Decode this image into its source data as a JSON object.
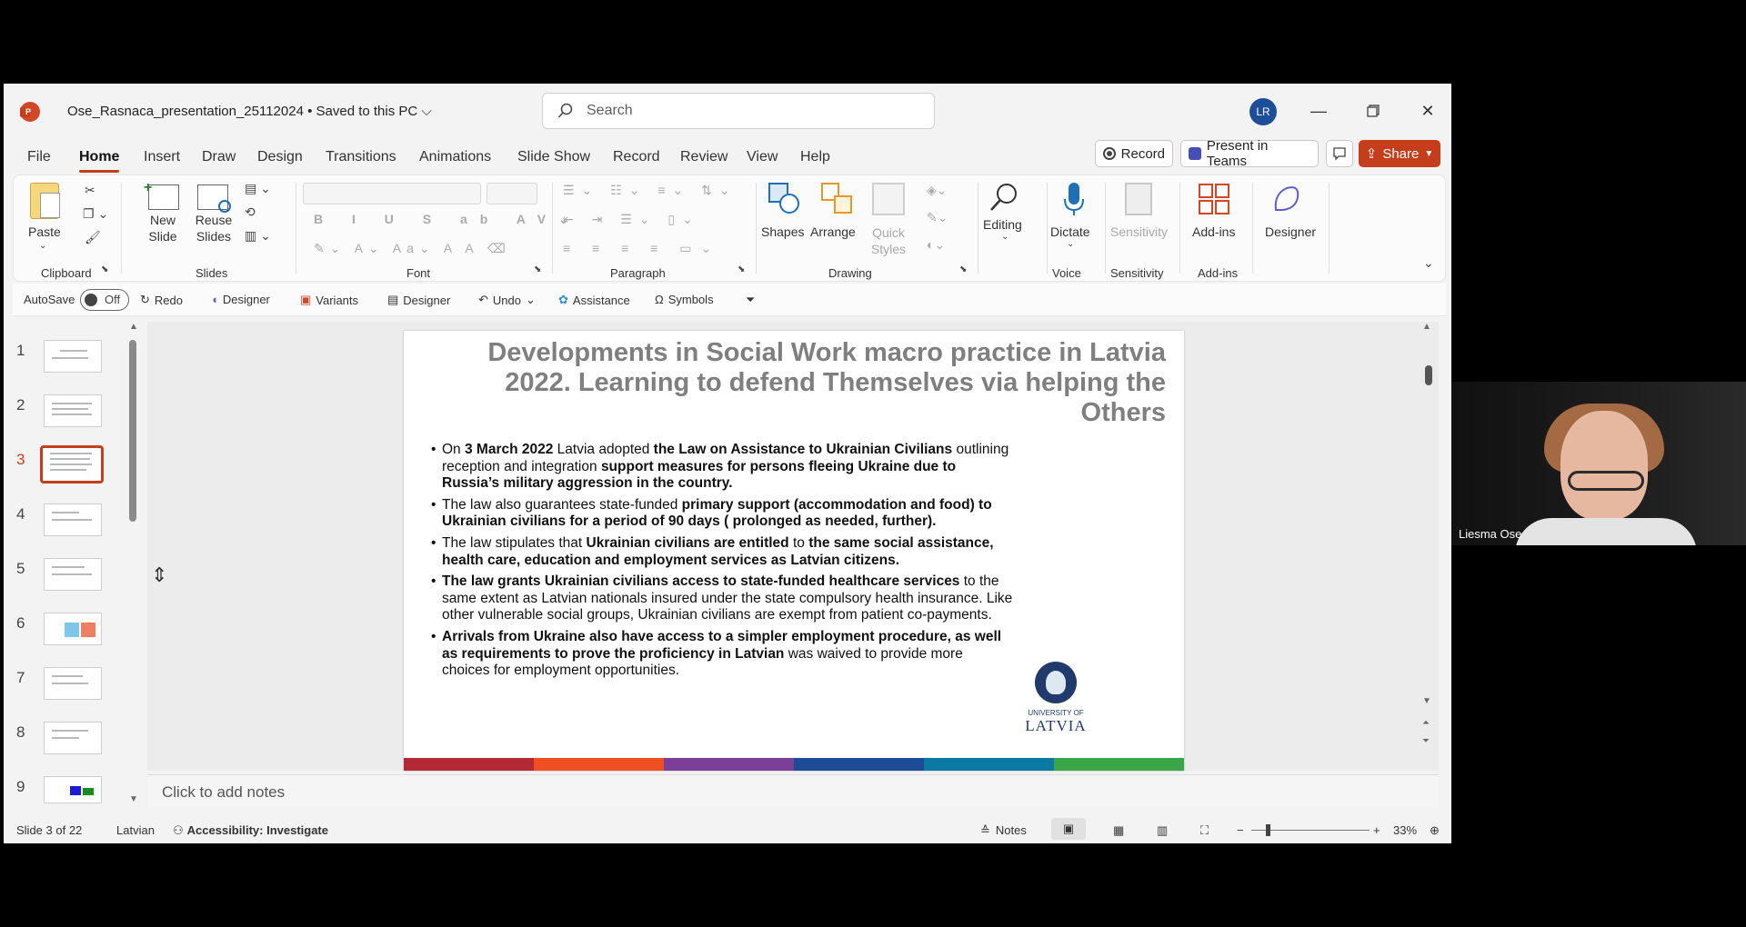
{
  "titlebar": {
    "document_title": "Ose_Rasnaca_presentation_25112024 • Saved to this PC ⌵",
    "search_placeholder": "Search",
    "avatar_initials": "LR"
  },
  "menu": {
    "tabs": [
      "File",
      "Home",
      "Insert",
      "Draw",
      "Design",
      "Transitions",
      "Animations",
      "Slide Show",
      "Record",
      "Review",
      "View",
      "Help"
    ],
    "active_tab": "Home",
    "record_button": "Record",
    "present_button": "Present in Teams",
    "share_button": "Share"
  },
  "ribbon": {
    "clipboard": {
      "paste": "Paste",
      "group": "Clipboard"
    },
    "slides": {
      "new_slide": "New Slide",
      "reuse_slides": "Reuse Slides",
      "group": "Slides"
    },
    "font": {
      "group": "Font"
    },
    "paragraph": {
      "group": "Paragraph"
    },
    "drawing": {
      "shapes": "Shapes",
      "arrange": "Arrange",
      "quick_styles": "Quick Styles",
      "group": "Drawing"
    },
    "editing": {
      "label": "Editing"
    },
    "voice": {
      "dictate": "Dictate",
      "group": "Voice"
    },
    "sensitivity": {
      "label": "Sensitivity",
      "group": "Sensitivity"
    },
    "addins": {
      "label": "Add-ins",
      "group": "Add-ins"
    },
    "designer": {
      "label": "Designer"
    }
  },
  "qat": {
    "autosave": "AutoSave",
    "autosave_state": "Off",
    "redo": "Redo",
    "designer1": "Designer",
    "variants": "Variants",
    "designer2": "Designer",
    "undo": "Undo",
    "assistance": "Assistance",
    "symbols": "Symbols"
  },
  "thumbnails": [
    "1",
    "2",
    "3",
    "4",
    "5",
    "6",
    "7",
    "8",
    "9"
  ],
  "active_slide_index": 3,
  "slide": {
    "title": "Developments in Social Work macro practice in Latvia 2022. Learning to defend Themselves via helping the Others",
    "bullets": [
      {
        "parts": [
          [
            "On ",
            false
          ],
          [
            "3 March 2022",
            true
          ],
          [
            " Latvia adopted ",
            false
          ],
          [
            "the Law on Assistance to Ukrainian Civilians",
            true
          ],
          [
            " outlining reception and integration ",
            false
          ],
          [
            "support measures for persons fleeing Ukraine due to Russia’s military aggression in the country.",
            true
          ]
        ]
      },
      {
        "parts": [
          [
            "The law also guarantees state-funded ",
            false
          ],
          [
            "primary support (accommodation and food) to Ukrainian civilians for a period of 90 days ( prolonged as needed, further).",
            true
          ]
        ]
      },
      {
        "parts": [
          [
            "The law stipulates that ",
            false
          ],
          [
            "Ukrainian civilians are entitled",
            true
          ],
          [
            " to ",
            false
          ],
          [
            "the same social assistance, health care, education and employment services as Latvian citizens.",
            true
          ]
        ]
      },
      {
        "parts": [
          [
            "The law grants Ukrainian civilians access to state-funded healthcare services",
            true
          ],
          [
            " to the same extent as Latvian nationals insured under the state compulsory health insurance. Like other vulnerable social groups, Ukrainian civilians are exempt from patient co-payments.",
            false
          ]
        ]
      },
      {
        "parts": [
          [
            "Arrivals from Ukraine also have access to a simpler employment procedure, as well as requirements to prove the proficiency in Latvian",
            true
          ],
          [
            " was waived to provide more choices for employment opportunities.",
            false
          ]
        ]
      }
    ],
    "logo_small": "UNIVERSITY OF",
    "logo_big": "LATVIA",
    "stripe_colors": [
      "#b22a35",
      "#f04e23",
      "#7b3f98",
      "#1e4b96",
      "#0b7aa3",
      "#3aa648"
    ]
  },
  "notes_placeholder": "Click to add notes",
  "status": {
    "slide_counter": "Slide 3 of 22",
    "language": "Latvian",
    "accessibility": "Accessibility: Investigate",
    "notes": "Notes",
    "zoom": "33%"
  },
  "video": {
    "participant_name": "Liesma Ose"
  },
  "colors": {
    "accent": "#c43e1c",
    "app_bg": "#f3f3f3"
  }
}
